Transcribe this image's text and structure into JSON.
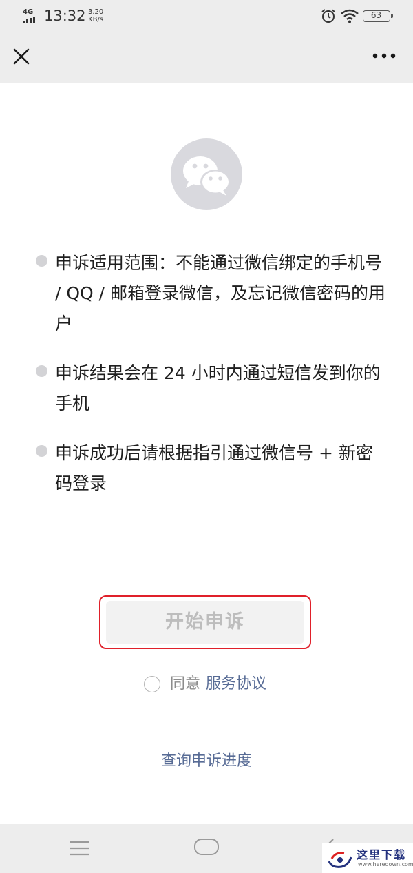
{
  "status_bar": {
    "network": "4G",
    "time": "13:32",
    "speed_value": "3.20",
    "speed_unit": "KB/s",
    "battery": "63"
  },
  "nav_bar": {
    "close_icon": "close-icon",
    "more_icon": "more-icon"
  },
  "logo_icon": "wechat-logo-icon",
  "bullets": [
    "申诉适用范围：不能通过微信绑定的手机号 / QQ / 邮箱登录微信，及忘记微信密码的用户",
    "申诉结果会在 24 小时内通过短信发到你的手机",
    "申诉成功后请根据指引通过微信号 + 新密码登录"
  ],
  "start_button": {
    "label": "开始申诉"
  },
  "agreement": {
    "prefix": "同意",
    "link": "服务协议"
  },
  "query_link": "查询申诉进度",
  "watermark": {
    "title": "这里下载",
    "url": "www.heredown.com"
  },
  "colors": {
    "bar_background": "#ededed",
    "link": "#576b95",
    "button_disabled_text": "#bdbdbd",
    "highlight_frame": "#e0202a"
  }
}
